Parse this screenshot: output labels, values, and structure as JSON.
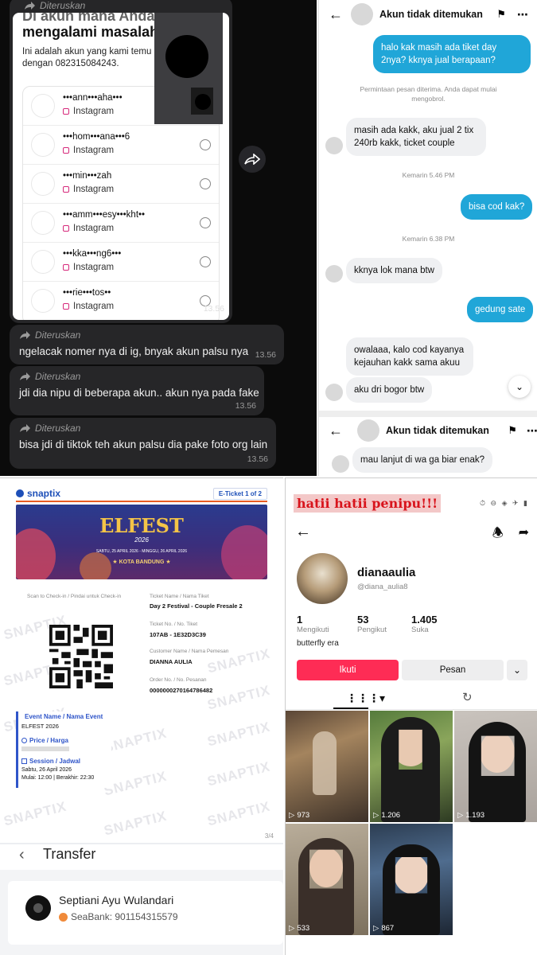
{
  "chat_dark": {
    "forwarded_label": "Diteruskan",
    "card": {
      "title_partial": "Di akun mana Anda",
      "title": "mengalami masalah",
      "subtitle_line1": "Ini adalah akun yang kami temu",
      "subtitle_line2": "dengan 082315084243.",
      "accounts": [
        {
          "name": "•••ann•••aha•••",
          "platform": "Instagram"
        },
        {
          "name": "•••hom•••ana•••6",
          "platform": "Instagram"
        },
        {
          "name": "•••min•••zah",
          "platform": "Instagram"
        },
        {
          "name": "•••amm•••esy•••kht••",
          "platform": "Instagram"
        },
        {
          "name": "•••kka•••ng6•••",
          "platform": "Instagram"
        },
        {
          "name": "•••rie•••tos••",
          "platform": "Instagram"
        }
      ],
      "time": "13.56"
    },
    "messages": [
      {
        "text": "ngelacak nomer nya di ig, bnyak akun palsu nya",
        "time": "13.56"
      },
      {
        "text": "jdi dia nipu di beberapa akun.. akun nya pada fake",
        "time": "13.56"
      },
      {
        "text": "bisa jdi di tiktok teh akun palsu dia pake foto org lain",
        "time": "13.56"
      }
    ]
  },
  "dm": {
    "header_title": "Akun tidak ditemukan",
    "msg1": "halo kak masih ada tiket day 2nya? kknya jual berapaan?",
    "request_note": "Permintaan pesan diterima. Anda dapat mulai mengobrol.",
    "msg2": "masih ada kakk, aku jual 2 tix 240rb kakk, ticket couple",
    "ts1": "Kemarin 5.46 PM",
    "msg3": "bisa cod kak?",
    "ts2": "Kemarin 6.38 PM",
    "msg4": "kknya lok mana btw",
    "msg5": "gedung sate",
    "msg6": "owalaaa, kalo cod kayanya kejauhan kakk sama akuu",
    "msg7": "aku dri bogor btw",
    "header2_title": "Akun tidak ditemukan",
    "msg8": "mau lanjut di wa ga biar enak?"
  },
  "ticket": {
    "brand": "snaptix",
    "eticket_label": "E-Ticket 1 of 2",
    "banner_title": "ELFEST",
    "banner_year": "2026",
    "banner_dates": "SABTU, 25 APRIL 2026 - MINGGU, 26 APRIL 2026",
    "banner_city": "★ KOTA BANDUNG ★",
    "scan_label": "Scan to Check-in / Pindai untuk Check-in",
    "ticket_name_label": "Ticket Name / Nama Tiket",
    "ticket_name": "Day 2 Festival - Couple Fresale 2",
    "ticket_no_label": "Ticket No. / No. Tiket",
    "ticket_no": "107AB - 1E32D3C39",
    "customer_label": "Customer Name / Nama Pemesan",
    "customer": "DIANNA AULIA",
    "order_label": "Order No. / No. Pesanan",
    "order_no": "0000000270164786482",
    "event_label": "Event Name / Nama Event",
    "event": "ELFEST 2026",
    "price_label": "Price / Harga",
    "session_label": "Session / Jadwal",
    "session_date": "Sabtu, 26 April 2026",
    "session_time": "Mulai: 12:00 | Berakhir: 22:30",
    "watermark": "SNAPTIX",
    "page": "3/4",
    "transfer_title": "Transfer",
    "recipient_name": "Septiani Ayu Wulandari",
    "recipient_bank": "SeaBank: 901154315579"
  },
  "tiktok": {
    "warning": "hatii hatii penipu!!!",
    "username": "dianaaulia",
    "handle": "@diana_aulia8",
    "stats": [
      {
        "value": "1",
        "label": "Mengikuti"
      },
      {
        "value": "53",
        "label": "Pengikut"
      },
      {
        "value": "1.405",
        "label": "Suka"
      }
    ],
    "bio": "butterfly era",
    "follow_label": "Ikuti",
    "message_label": "Pesan",
    "videos": [
      {
        "views": "973"
      },
      {
        "views": "1.206"
      },
      {
        "views": "1.193"
      },
      {
        "views": "533"
      },
      {
        "views": "867"
      }
    ],
    "colors": {
      "follow": "#fe2c55",
      "warning_bg": "#f3c8c8",
      "warning_text": "#d8141c"
    }
  }
}
